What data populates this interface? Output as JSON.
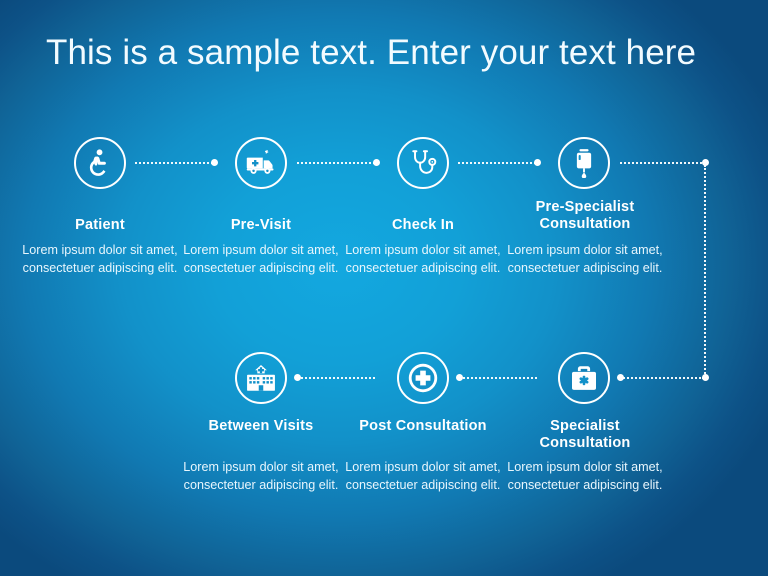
{
  "slide": {
    "title": "This is a sample text. Enter your text here",
    "background_center_color": "#12a3dc",
    "background_edge_color": "#0d5287",
    "text_color": "#ffffff"
  },
  "steps": [
    {
      "id": "patient",
      "icon": "wheelchair-icon",
      "heading": "Patient",
      "body": "Lorem ipsum dolor sit amet, consectetuer adipiscing elit."
    },
    {
      "id": "pre-visit",
      "icon": "ambulance-icon",
      "heading": "Pre-Visit",
      "body": "Lorem ipsum dolor sit amet, consectetuer adipiscing elit."
    },
    {
      "id": "check-in",
      "icon": "stethoscope-icon",
      "heading": "Check In",
      "body": "Lorem ipsum dolor sit amet, consectetuer adipiscing elit."
    },
    {
      "id": "pre-specialist-consultation",
      "icon": "iv-drip-icon",
      "heading": "Pre-Specialist Consultation",
      "body": "Lorem ipsum dolor sit amet, consectetuer adipiscing elit."
    },
    {
      "id": "between-visits",
      "icon": "hospital-building-icon",
      "heading": "Between Visits",
      "body": "Lorem ipsum dolor sit amet, consectetuer adipiscing elit."
    },
    {
      "id": "post-consultation",
      "icon": "medical-cross-circle-icon",
      "heading": "Post Consultation",
      "body": "Lorem ipsum dolor sit amet, consectetuer adipiscing elit."
    },
    {
      "id": "specialist-consultation",
      "icon": "medical-bag-icon",
      "heading": "Specialist Consultation",
      "body": "Lorem ipsum dolor sit amet, consectetuer adipiscing elit."
    }
  ]
}
